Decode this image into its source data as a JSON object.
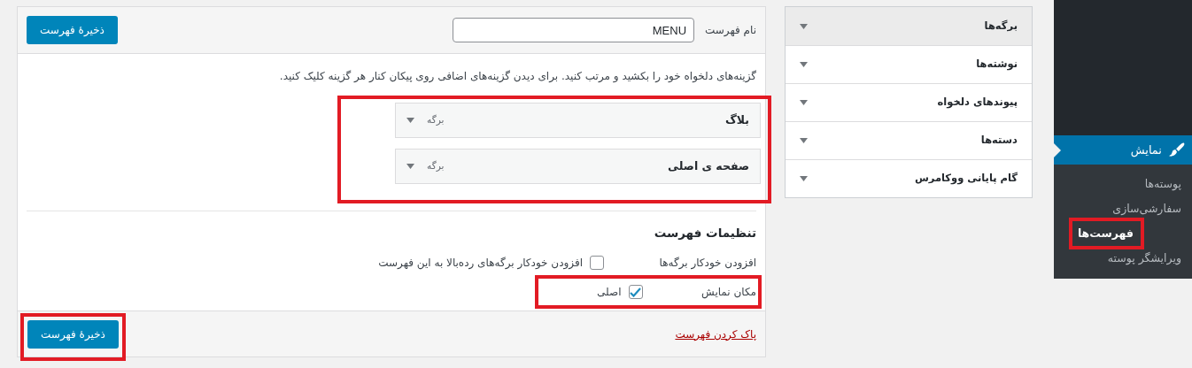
{
  "sidebar": {
    "section": {
      "label": "نمایش",
      "selected": true
    },
    "submenu": [
      {
        "label": "پوسته‌ها",
        "selected": false,
        "highlighted": false
      },
      {
        "label": "سفارشی‌سازی",
        "selected": false,
        "highlighted": false
      },
      {
        "label": "فهرست‌ها",
        "selected": true,
        "highlighted": true
      },
      {
        "label": "ویرایشگر پوسته",
        "selected": false,
        "highlighted": false
      }
    ]
  },
  "add_items": [
    {
      "title": "برگه‌ها",
      "expanded": true
    },
    {
      "title": "نوشته‌ها",
      "expanded": false
    },
    {
      "title": "پیوندهای دلخواه",
      "expanded": false
    },
    {
      "title": "دسته‌ها",
      "expanded": false
    },
    {
      "title": "گام پایانی ووکامرس",
      "expanded": false
    }
  ],
  "menu_editor": {
    "name_label": "نام فهرست",
    "name_value": "MENU",
    "save_button": {
      "label": "ذخیرهٔ فهرست",
      "highlighted": false
    },
    "instructions": "گزینه‌های دلخواه خود را بکشید و مرتب کنید. برای دیدن گزینه‌های اضافی روی پیکان کنار هر گزینه کلیک کنید.",
    "items_highlighted": true,
    "items": [
      {
        "title": "بلاگ",
        "type": "برگه"
      },
      {
        "title": "صفحه ی اصلی",
        "type": "برگه"
      }
    ],
    "settings": {
      "heading": "تنظیمات فهرست",
      "rows": [
        {
          "label": "افزودن خودکار برگه‌ها",
          "highlighted": false,
          "options": [
            {
              "label": "افزودن خودکار برگه‌های رده‌بالا به این فهرست",
              "checked": false
            }
          ]
        },
        {
          "label": "مکان نمایش",
          "highlighted": true,
          "options": [
            {
              "label": "اصلی",
              "checked": true
            }
          ]
        }
      ]
    },
    "delete_link": "پاک کردن فهرست",
    "save_button_bottom": {
      "label": "ذخیرهٔ فهرست",
      "highlighted": true
    }
  }
}
